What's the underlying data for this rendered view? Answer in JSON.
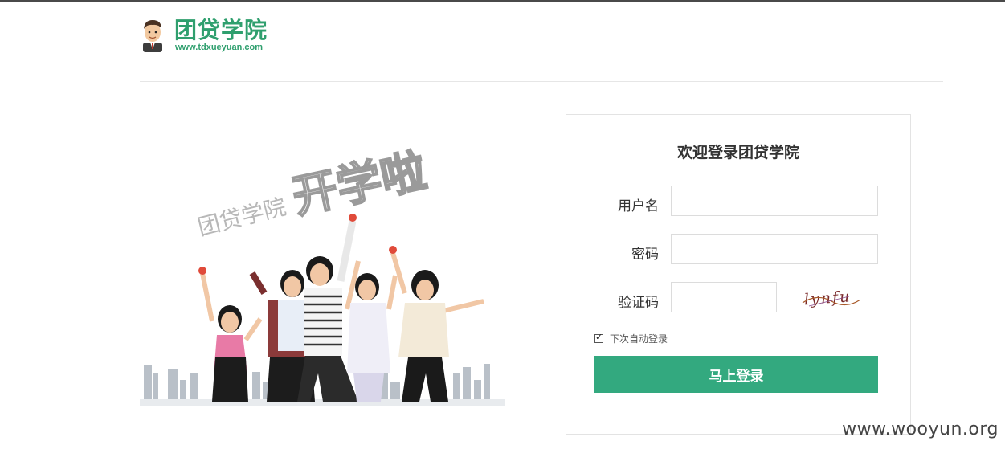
{
  "header": {
    "brand": "团贷学院",
    "url": "www.tdxueyuan.com"
  },
  "hero": {
    "school_text": "团贷学院",
    "slogan": "开学啦"
  },
  "login": {
    "title": "欢迎登录团贷学院",
    "username_label": "用户名",
    "username_value": "",
    "password_label": "密码",
    "password_value": "",
    "captcha_label": "验证码",
    "captcha_value": "",
    "captcha_text": "lynfu",
    "remember_label": "下次自动登录",
    "remember_checked": true,
    "submit_label": "马上登录"
  },
  "watermark": "www.wooyun.org",
  "colors": {
    "brand_green": "#2f9f6e",
    "button_green": "#33a97f"
  }
}
